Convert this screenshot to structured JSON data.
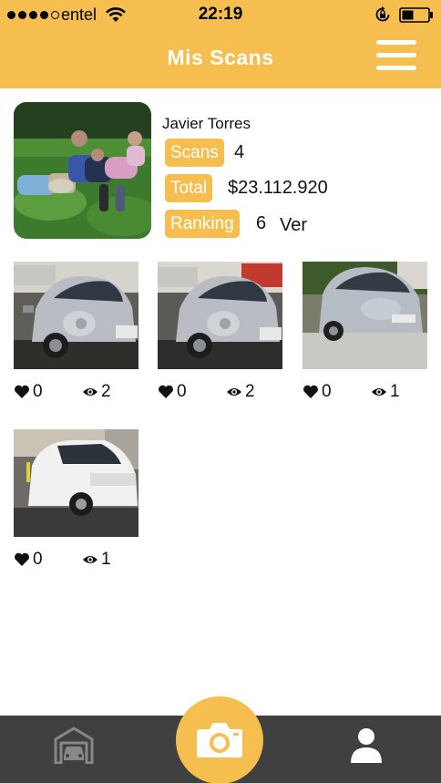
{
  "status_bar": {
    "carrier": "entel",
    "time": "22:19",
    "signal_bars": 4,
    "signal_total": 5
  },
  "nav": {
    "title": "Mis Scans",
    "menu_icon": "menu-icon"
  },
  "profile": {
    "name": "Javier Torres",
    "scans_label": "Scans",
    "scans_value": "4",
    "total_label": "Total",
    "total_value": "$23.112.920",
    "ranking_label": "Ranking",
    "ranking_value": "6",
    "ver_label": "Ver"
  },
  "scans": [
    {
      "likes": "0",
      "views": "2",
      "car_color": "#b9bcc2",
      "model": "beetle"
    },
    {
      "likes": "0",
      "views": "2",
      "car_color": "#b9bcc2",
      "model": "beetle"
    },
    {
      "likes": "0",
      "views": "1",
      "car_color": "#b6bcc4",
      "model": "hatchback"
    },
    {
      "likes": "0",
      "views": "1",
      "car_color": "#f1f1f1",
      "model": "wagon"
    }
  ],
  "tab_bar": {
    "left_icon": "garage-icon",
    "center_icon": "camera-icon",
    "right_icon": "profile-icon"
  },
  "colors": {
    "accent": "#f6bd4f",
    "tab_bar": "#404040"
  }
}
